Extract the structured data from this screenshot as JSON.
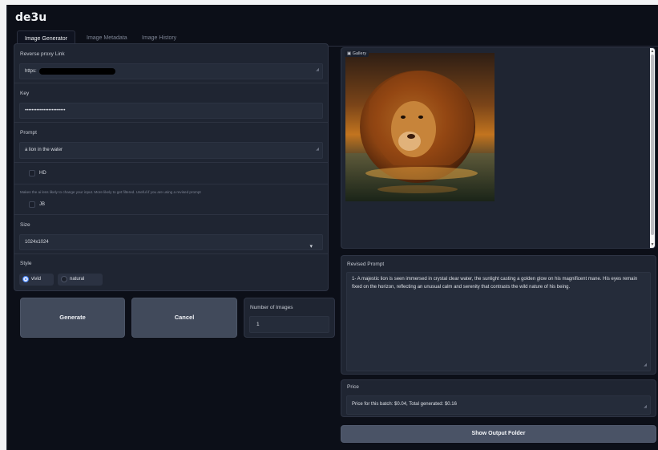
{
  "app": {
    "title": "de3u"
  },
  "tabs": [
    {
      "label": "Image Generator",
      "active": true
    },
    {
      "label": "Image Metadata",
      "active": false
    },
    {
      "label": "Image History",
      "active": false
    }
  ],
  "form": {
    "proxy": {
      "label": "Reverse proxy Link",
      "value": "https:"
    },
    "key": {
      "label": "Key",
      "value": "••••••••••••••••••••••••"
    },
    "prompt": {
      "label": "Prompt",
      "value": "a lion in the water"
    },
    "hd": {
      "label": "HD",
      "checked": false
    },
    "jb": {
      "hint": "Makes the ai less likely to change your input. More likely to get filtered. Useful if you are using a revised prompt",
      "label": "JB",
      "checked": false
    },
    "size": {
      "label": "Size",
      "value": "1024x1024"
    },
    "style": {
      "label": "Style",
      "options": [
        {
          "label": "vivid",
          "checked": true
        },
        {
          "label": "natural",
          "checked": false
        }
      ]
    }
  },
  "actions": {
    "generate": "Generate",
    "cancel": "Cancel"
  },
  "num_images": {
    "label": "Number of Images",
    "value": "1"
  },
  "gallery": {
    "label": "Gallery"
  },
  "revised_prompt": {
    "label": "Revised Prompt",
    "text": "1- A majestic lion is seen immersed in crystal clear water, the sunlight casting a golden glow on his magnificent mane. His eyes remain fixed on the horizon, reflecting an unusual calm and serenity that contrasts the wild nature of his being."
  },
  "price": {
    "label": "Price",
    "text": "Price for this batch: $0.04, Total generated: $0.16"
  },
  "show_output": "Show Output Folder",
  "colors": {
    "background": "#0c0f18",
    "panel": "#1f2532",
    "accent": "#3f7ef2",
    "button": "#414a5b"
  }
}
